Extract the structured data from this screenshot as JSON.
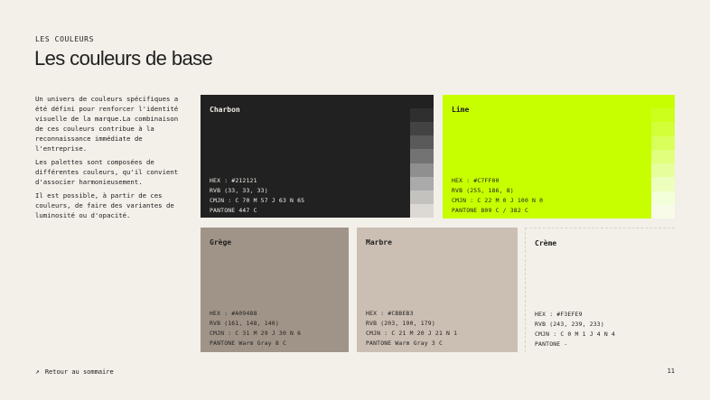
{
  "header": {
    "eyebrow": "LES COULEURS",
    "title": "Les couleurs de base"
  },
  "intro": {
    "paragraphs": [
      "Un univers de couleurs spécifiques a été défini pour renforcer l'identité visuelle de la marque.La combinaison de ces couleurs contribue à la reconnaissance immédiate de l'entreprise.",
      "Les palettes sont composées de différentes couleurs, qu'il convient d'associer harmonieusement.",
      "Il est possible, à partir de ces couleurs, de faire des variantes de luminosité ou d'opacité."
    ]
  },
  "colors": [
    {
      "name": "Charbon",
      "hex": "HEX : #212121",
      "rvb": "RVB (33, 33, 33)",
      "cmjn": "CMJN : C 70 M 57 J 63 N 65",
      "pantone": "PANTONE 447 C",
      "color": "#212121"
    },
    {
      "name": "Lime",
      "hex": "HEX : #C7FF00",
      "rvb": "RVB (255, 186, 8)",
      "cmjn": "CMJN : C 22 M 0 J 100 N 0",
      "pantone": "PANTONE 809 C / 382 C",
      "color": "#C7FF00"
    },
    {
      "name": "Grège",
      "hex": "HEX : #A09488",
      "rvb": "RVB (161, 148, 140)",
      "cmjn": "CMJN : C 31 M 29 J 30 N 6",
      "pantone": "PANTONE Warm Gray 8 C",
      "color": "#A09488"
    },
    {
      "name": "Marbre",
      "hex": "HEX : #CBBEB3",
      "rvb": "RVB (203, 190, 179)",
      "cmjn": "CMJN : C 21 M 20 J 21 N 1",
      "pantone": "PANTONE Warm Gray 3 C",
      "color": "#CBBEB3"
    },
    {
      "name": "Crème",
      "hex": "HEX : #F3EFE9",
      "rvb": "RVB (243, 239, 233)",
      "cmjn": "CMJN : C 0 M 1 J 4 N 4",
      "pantone": "PANTONE -",
      "color": "#F3EFE9"
    }
  ],
  "footer": {
    "link_label": "Retour au sommaire",
    "link_icon": "arrow-up-left-icon",
    "page_number": "11"
  }
}
